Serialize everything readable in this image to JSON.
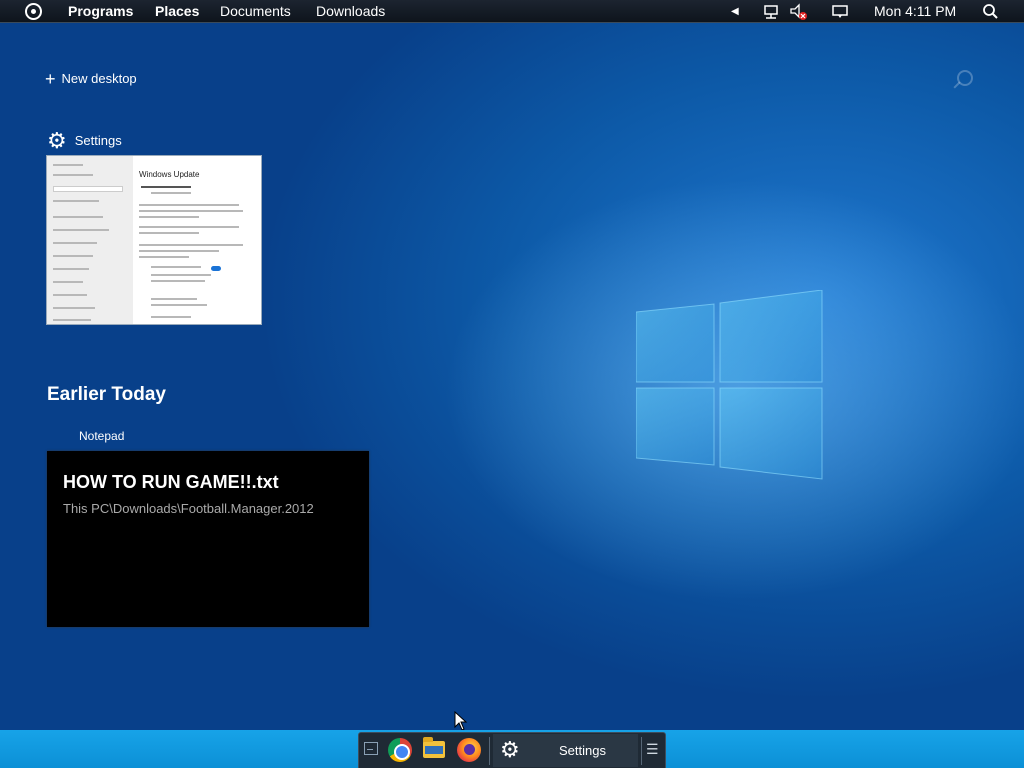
{
  "topbar": {
    "menu": [
      "Programs",
      "Places",
      "Documents",
      "Downloads"
    ],
    "clock": "Mon 4:11 PM",
    "icons": [
      "app-menu-icon",
      "arrow-left-icon",
      "network-icon",
      "volume-muted-icon",
      "notification-icon",
      "search-icon"
    ]
  },
  "overview": {
    "new_desktop": "New desktop",
    "windows": [
      {
        "title": "Settings",
        "icon": "gear-icon",
        "preview_heading": "Windows Update"
      }
    ],
    "earlier_heading": "Earlier Today",
    "earlier": [
      {
        "app": "Notepad",
        "file": "HOW TO RUN GAME!!.txt",
        "path": "This PC\\Downloads\\Football.Manager.2012"
      }
    ]
  },
  "taskbar": {
    "launchers": [
      "show-desktop-icon",
      "chromium-icon",
      "file-manager-icon",
      "firefox-icon"
    ],
    "task_label": "Settings",
    "colors": {
      "panel": "#1f2a35",
      "strip": "#17a3e8"
    }
  }
}
